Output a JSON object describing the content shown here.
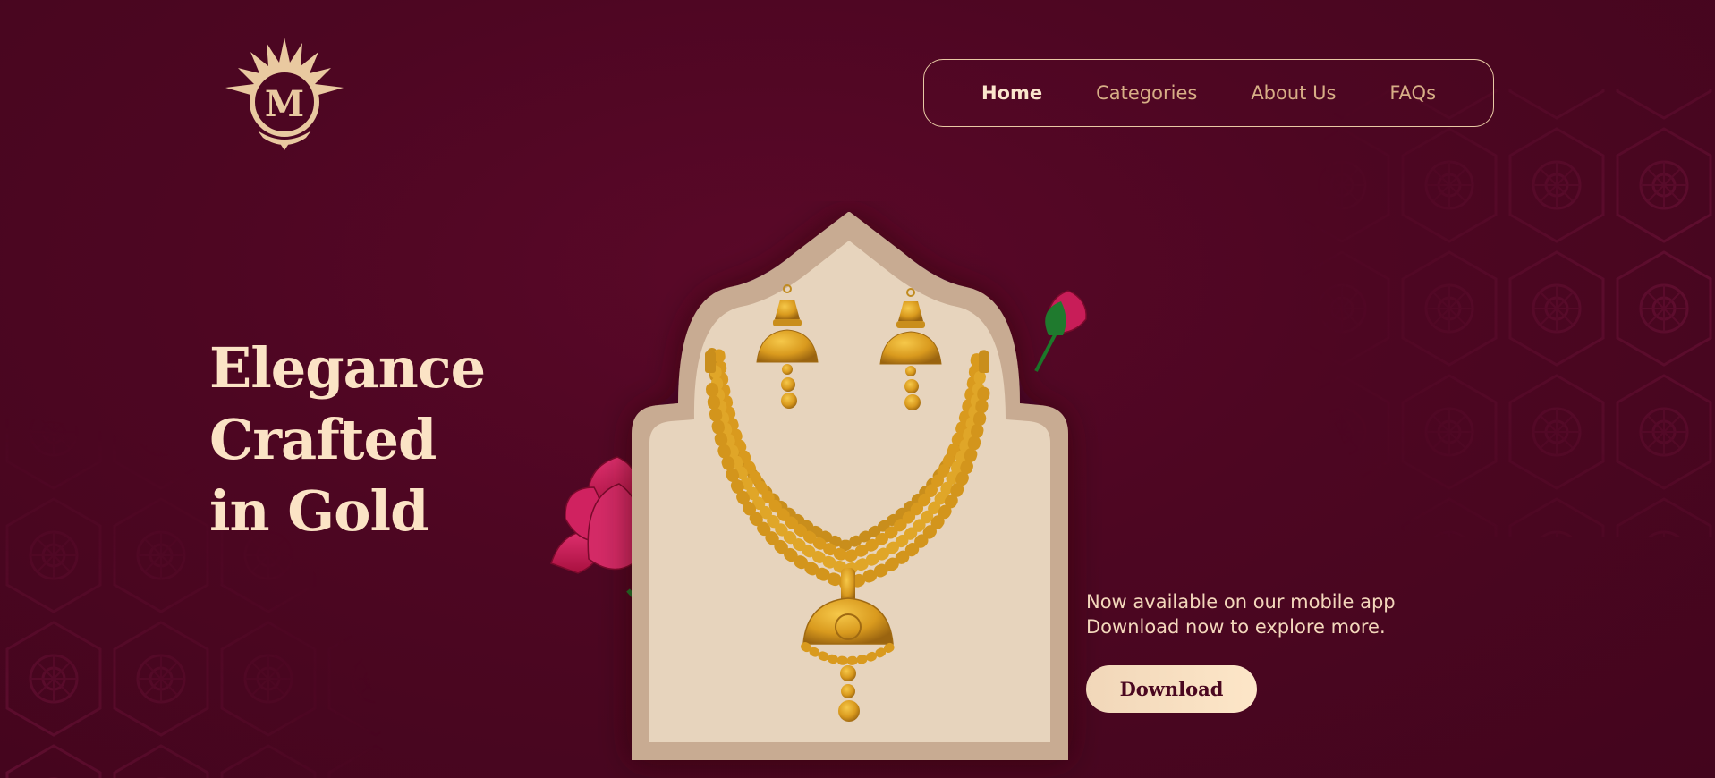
{
  "brand": {
    "logo_icon": "monogram-sunburst-logo"
  },
  "nav": {
    "items": [
      {
        "label": "Home",
        "active": true
      },
      {
        "label": "Categories",
        "active": false
      },
      {
        "label": "About Us",
        "active": false
      },
      {
        "label": "FAQs",
        "active": false
      }
    ]
  },
  "hero": {
    "headline_line1": "Elegance Crafted",
    "headline_line2": "in Gold",
    "promo_line1": "Now available on our mobile app",
    "promo_line2": "Download now to explore more.",
    "download_label": "Download",
    "image_icon": "gold-necklace-earrings-set"
  },
  "colors": {
    "background": "#4d0622",
    "accent_cream": "#fbe3c5",
    "nav_inactive": "#d7ae86",
    "gold": "#d9a024",
    "lotus": "#c81e5c"
  }
}
